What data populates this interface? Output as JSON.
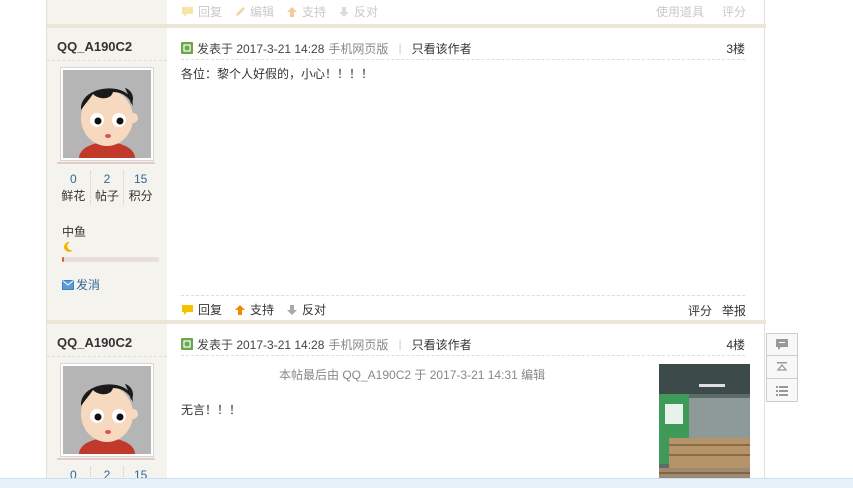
{
  "prev_footer": {
    "reply": "回复",
    "edit": "编辑",
    "support": "支持",
    "oppose": "反对",
    "use_tool": "使用道具",
    "rate": "评分"
  },
  "posts": [
    {
      "username": "QQ_A190C2",
      "stats": [
        {
          "num": "0",
          "label": "鲜花"
        },
        {
          "num": "2",
          "label": "帖子"
        },
        {
          "num": "15",
          "label": "积分"
        }
      ],
      "group": "中鱼",
      "message": "发消",
      "published": "发表于 2017-3-21 14:28",
      "via": "手机网页版",
      "only_author": "只看该作者",
      "floor": "3楼",
      "content": "各位：黎个人好假的，小心！！！！",
      "actions": {
        "reply": "回复",
        "support": "支持",
        "oppose": "反对"
      },
      "foot_right": {
        "rate": "评分",
        "report": "举报"
      }
    },
    {
      "username": "QQ_A190C2",
      "stats": [
        {
          "num": "0",
          "label": ""
        },
        {
          "num": "2",
          "label": ""
        },
        {
          "num": "15",
          "label": ""
        }
      ],
      "published": "发表于 2017-3-21 14:28",
      "via": "手机网页版",
      "only_author": "只看该作者",
      "floor": "4楼",
      "edit_note": "本帖最后由 QQ_A190C2 于 2017-3-21 14:31 编辑",
      "content": "无言！！！"
    }
  ],
  "side_tools": [
    "comment-icon",
    "back-to-top-icon",
    "list-icon"
  ],
  "colors": {
    "link": "#336699",
    "side_bg": "#f5f3ee",
    "separator": "#ebe6d8"
  }
}
